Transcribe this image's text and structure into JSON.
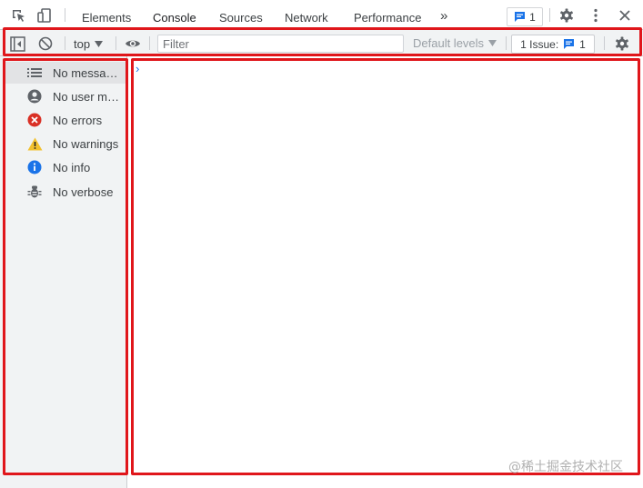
{
  "tabs": [
    {
      "label": "Elements"
    },
    {
      "label": "Console"
    },
    {
      "label": "Sources"
    },
    {
      "label": "Network"
    },
    {
      "label": "Performance"
    }
  ],
  "active_tab": "Console",
  "more_tabs_glyph": "»",
  "messages_badge": {
    "count": "1"
  },
  "toolbar": {
    "context": "top",
    "filter_placeholder": "Filter",
    "levels_label": "Default levels",
    "issues_label": "1 Issue:",
    "issues_count": "1"
  },
  "sidebar": {
    "items": [
      {
        "label": "No messages",
        "icon": "list-icon"
      },
      {
        "label": "No user me…",
        "icon": "user-icon"
      },
      {
        "label": "No errors",
        "icon": "error-icon"
      },
      {
        "label": "No warnings",
        "icon": "warning-icon"
      },
      {
        "label": "No info",
        "icon": "info-icon"
      },
      {
        "label": "No verbose",
        "icon": "bug-icon"
      }
    ]
  },
  "console": {
    "prompt": "›"
  },
  "watermark": "@稀土掘金技术社区",
  "colors": {
    "accent": "#1a73e8",
    "highlight": "#e0161b",
    "error": "#d93025",
    "warning": "#f2c12e"
  }
}
